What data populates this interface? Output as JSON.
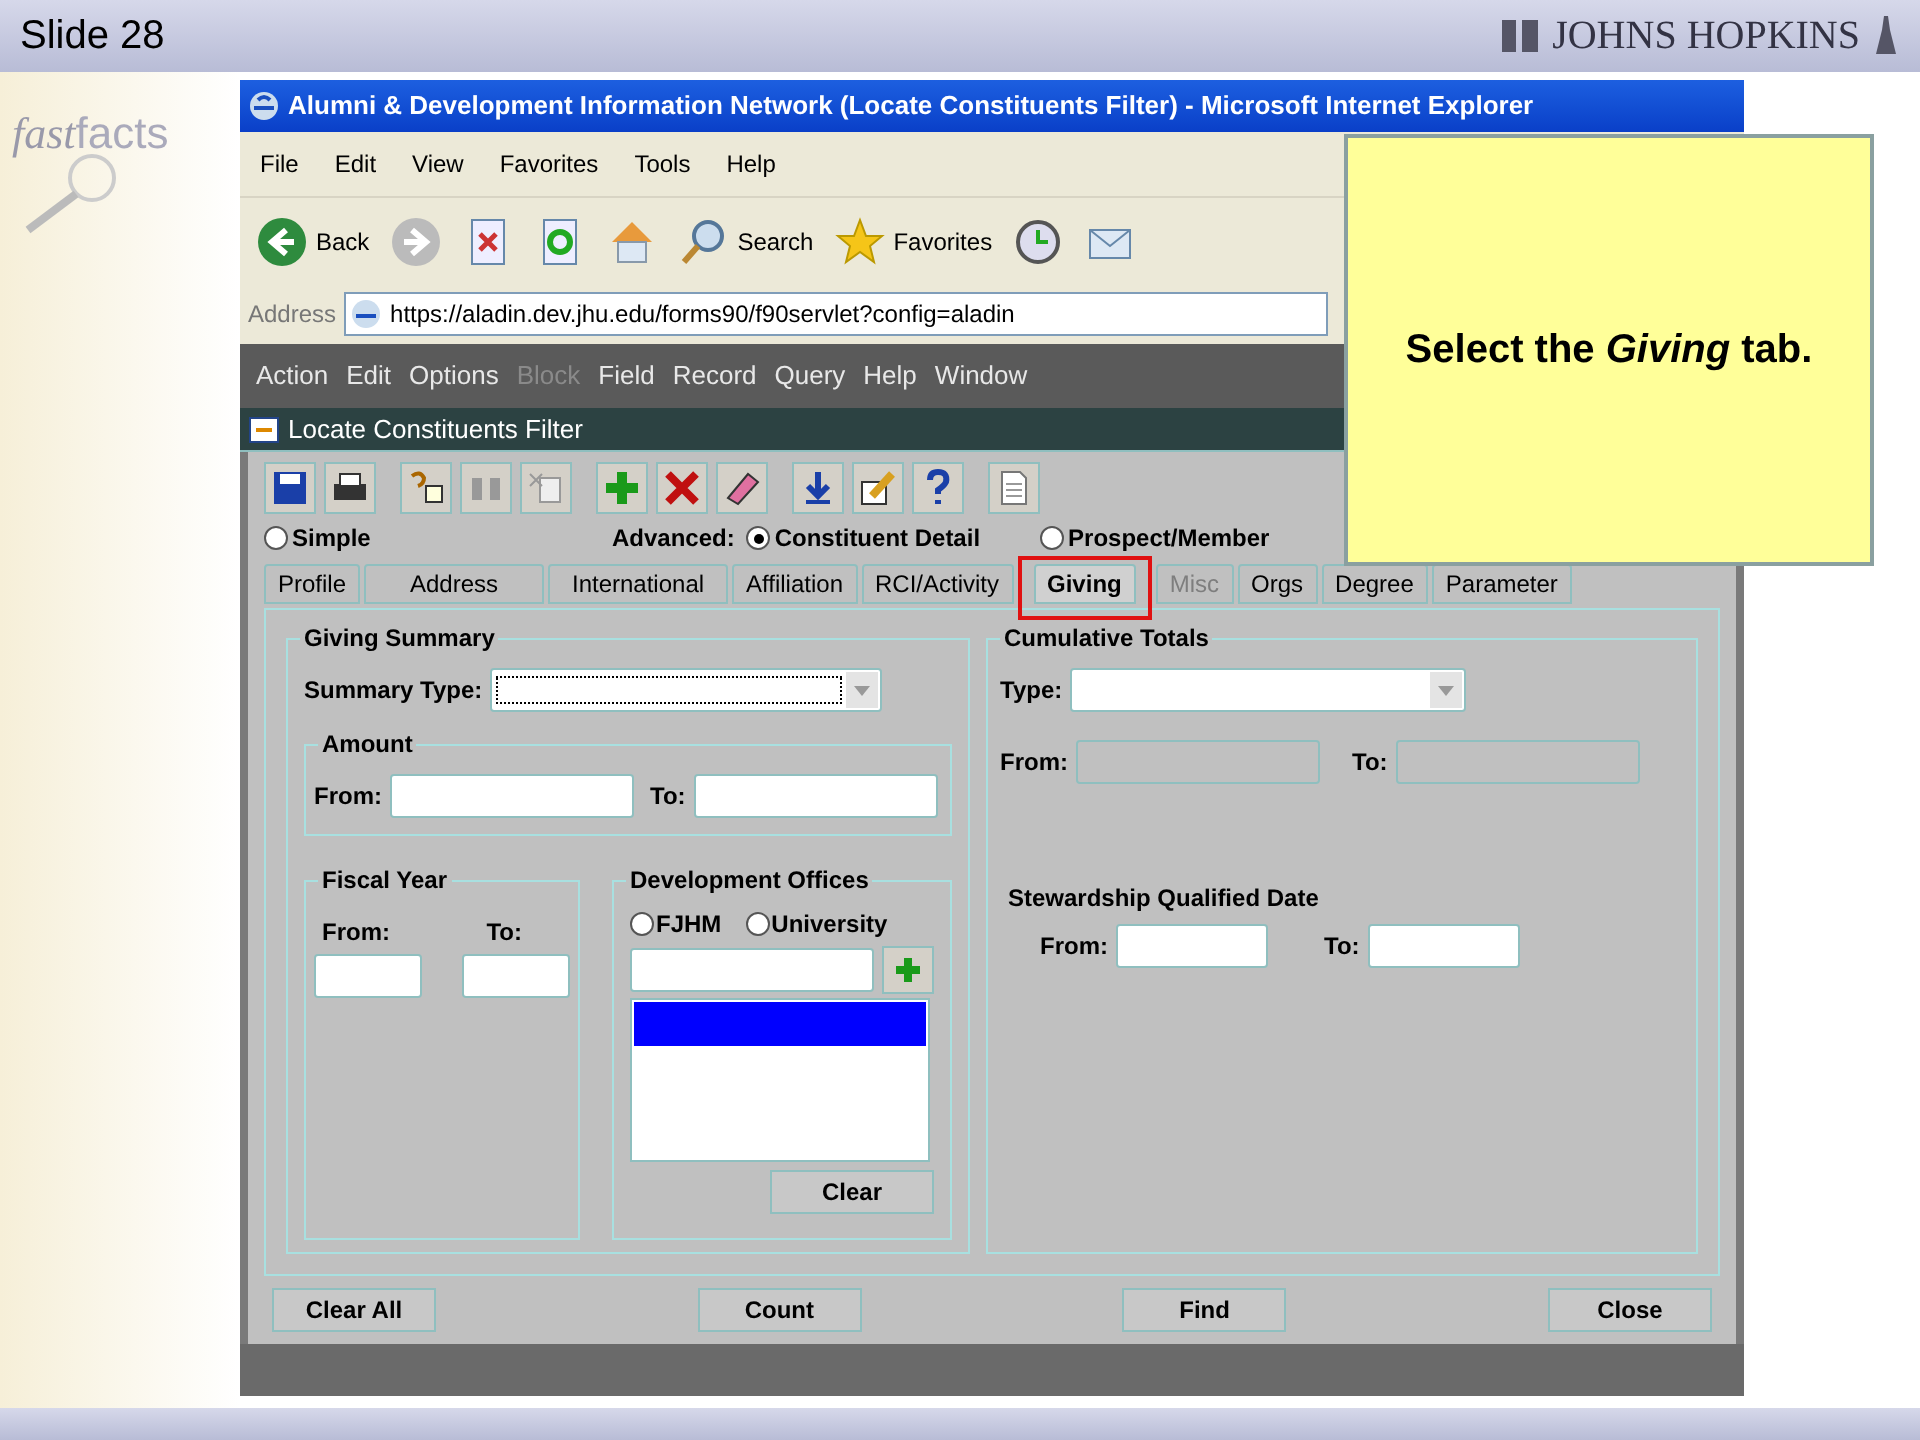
{
  "slide": {
    "title": "Slide 28",
    "logo": "JOHNS HOPKINS",
    "brand_parts": [
      "fast",
      "facts"
    ]
  },
  "browser": {
    "title": "Alumni & Development Information Network (Locate Constituents Filter) - Microsoft Internet Explorer",
    "menu": [
      "File",
      "Edit",
      "View",
      "Favorites",
      "Tools",
      "Help"
    ],
    "toolbar": [
      {
        "kind": "back",
        "label": "Back"
      },
      {
        "kind": "forward"
      },
      {
        "kind": "stop"
      },
      {
        "kind": "refresh"
      },
      {
        "kind": "home"
      },
      {
        "kind": "search",
        "label": "Search"
      },
      {
        "kind": "favorites",
        "label": "Favorites"
      },
      {
        "kind": "history"
      },
      {
        "kind": "mail"
      }
    ],
    "address_label": "Address",
    "url": "https://aladin.dev.jhu.edu/forms90/f90servlet?config=aladin"
  },
  "app": {
    "menu": [
      {
        "label": "Action",
        "disabled": false
      },
      {
        "label": "Edit",
        "disabled": false
      },
      {
        "label": "Options",
        "disabled": false
      },
      {
        "label": "Block",
        "disabled": true
      },
      {
        "label": "Field",
        "disabled": false
      },
      {
        "label": "Record",
        "disabled": false
      },
      {
        "label": "Query",
        "disabled": false
      },
      {
        "label": "Help",
        "disabled": false
      },
      {
        "label": "Window",
        "disabled": false
      }
    ],
    "window_title": "Locate Constituents Filter",
    "toolbar": [
      {
        "kind": "save",
        "disabled": false
      },
      {
        "kind": "print",
        "disabled": false
      },
      {
        "kind": "query",
        "disabled": false
      },
      {
        "kind": "binoculars",
        "disabled": true
      },
      {
        "kind": "clear",
        "disabled": true
      },
      {
        "kind": "add",
        "disabled": false
      },
      {
        "kind": "delete",
        "disabled": false
      },
      {
        "kind": "eraser",
        "disabled": false
      },
      {
        "kind": "download",
        "disabled": false
      },
      {
        "kind": "edit",
        "disabled": false
      },
      {
        "kind": "help",
        "disabled": false
      },
      {
        "kind": "document",
        "disabled": false
      }
    ],
    "simple": {
      "label": "Simple",
      "selected": false
    },
    "advanced_label": "Advanced:",
    "advanced_options": [
      {
        "label": "Constituent Detail",
        "selected": true
      },
      {
        "label": "Prospect/Member",
        "selected": false
      }
    ],
    "tabs": [
      {
        "label": "Profile",
        "selected": false,
        "disabled": false,
        "highlighted": false
      },
      {
        "label": "Address",
        "selected": false,
        "disabled": false,
        "highlighted": false
      },
      {
        "label": "International",
        "selected": false,
        "disabled": false,
        "highlighted": false
      },
      {
        "label": "Affiliation",
        "selected": false,
        "disabled": false,
        "highlighted": false
      },
      {
        "label": "RCI/Activity",
        "selected": false,
        "disabled": false,
        "highlighted": false
      },
      {
        "label": "Giving",
        "selected": true,
        "disabled": false,
        "highlighted": true
      },
      {
        "label": "Misc",
        "selected": false,
        "disabled": true,
        "highlighted": false
      },
      {
        "label": "Orgs",
        "selected": false,
        "disabled": false,
        "highlighted": false
      },
      {
        "label": "Degree",
        "selected": false,
        "disabled": false,
        "highlighted": false
      },
      {
        "label": "Parameter",
        "selected": false,
        "disabled": false,
        "highlighted": false
      }
    ],
    "giving_summary": {
      "title": "Giving Summary",
      "summary_type_label": "Summary Type:",
      "amount": {
        "title": "Amount",
        "from_label": "From:",
        "to_label": "To:"
      }
    },
    "fiscal_year": {
      "title": "Fiscal Year",
      "from_label": "From:",
      "to_label": "To:"
    },
    "development_offices": {
      "title": "Development Offices",
      "options": [
        {
          "label": "FJHM",
          "selected": false
        },
        {
          "label": "University",
          "selected": false
        }
      ],
      "clear_button": "Clear"
    },
    "cumulative_totals": {
      "title": "Cumulative Totals",
      "type_label": "Type:",
      "from_label": "From:",
      "to_label": "To:"
    },
    "stewardship": {
      "title": "Stewardship Qualified Date",
      "from_label": "From:",
      "to_label": "To:"
    },
    "buttons": [
      "Clear All",
      "Count",
      "Find",
      "Close"
    ]
  },
  "callout": {
    "text": "Select the *Giving* tab."
  }
}
